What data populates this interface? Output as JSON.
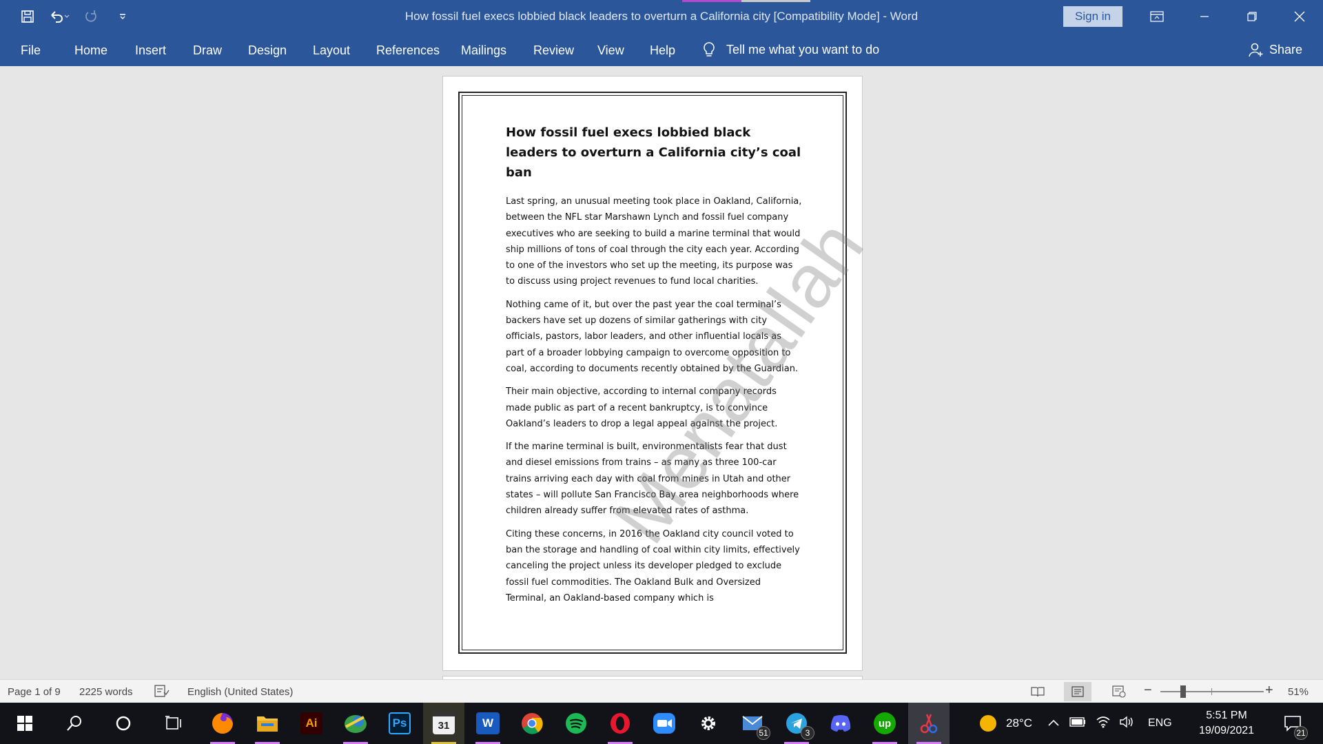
{
  "window": {
    "title": "How fossil fuel execs lobbied black leaders to overturn a California city [Compatibility Mode]  -  Word",
    "sign_in": "Sign in"
  },
  "ribbon": {
    "tabs": [
      "File",
      "Home",
      "Insert",
      "Draw",
      "Design",
      "Layout",
      "References",
      "Mailings",
      "Review",
      "View",
      "Help"
    ],
    "tell_me": "Tell me what you want to do",
    "share": "Share"
  },
  "document": {
    "title": "How fossil fuel execs lobbied black leaders to overturn a California city’s coal ban",
    "paragraphs": [
      "Last spring, an unusual meeting took place in Oakland, California, between the NFL star Marshawn Lynch and fossil fuel company executives who are seeking to build a marine terminal that would ship millions of tons of coal through the city each year. According to one of the investors who set up the meeting, its purpose was to discuss using project revenues to fund local charities.",
      "Nothing came of it, but over the past year the coal terminal’s backers have set up dozens of similar gatherings with city officials, pastors, labor leaders, and other influential locals as part of a broader lobbying campaign to overcome opposition to coal, according to documents recently obtained by the Guardian.",
      "Their main objective, according to internal company records made public as part of a recent bankruptcy, is to convince Oakland’s leaders to drop a legal appeal against the project.",
      "If the marine terminal is built, environmentalists fear that dust and diesel emissions from trains – as many as three 100-car trains arriving each day with coal from mines in Utah and other states – will pollute San Francisco Bay area neighborhoods where children already suffer from elevated rates of asthma.",
      "Citing these concerns, in 2016 the Oakland city council voted to ban the storage and handling of coal within city limits, effectively canceling the project unless its developer pledged to exclude fossil fuel commodities. The Oakland Bulk and Oversized Terminal, an Oakland-based company which is"
    ],
    "watermark": "Menatallah"
  },
  "statusbar": {
    "page": "Page 1 of 9",
    "words": "2225 words",
    "language": "English (United States)",
    "zoom": "51%",
    "zoom_level": 0.51
  },
  "taskbar": {
    "weather": "28°C",
    "lang": "ENG",
    "time": "5:51 PM",
    "date": "19/09/2021",
    "mail_badge": "51",
    "telegram_badge": "3",
    "notif_badge": "21",
    "calendar_label": "31"
  },
  "colors": {
    "accent": "#2b579a",
    "taskbar": "#111318"
  }
}
